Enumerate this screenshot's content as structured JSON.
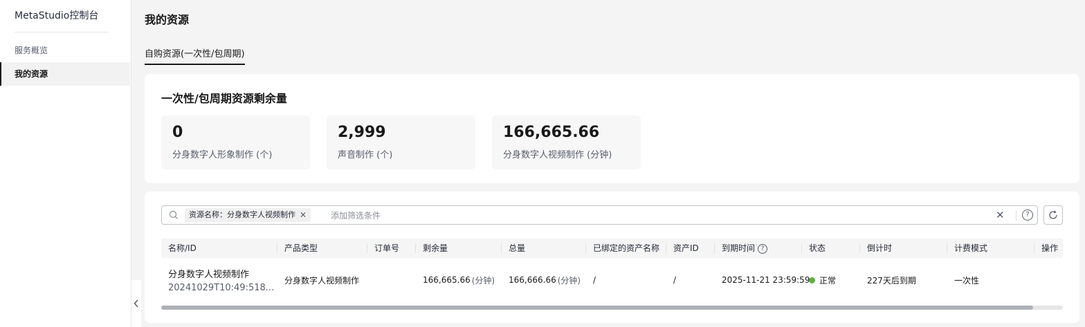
{
  "sidebar": {
    "title": "MetaStudio控制台",
    "items": [
      {
        "label": "服务概览"
      },
      {
        "label": "我的资源"
      }
    ],
    "collapse_icon": "chevron-left-icon"
  },
  "page": {
    "title": "我的资源",
    "tab": "自购资源(一次性/包周期)"
  },
  "summary": {
    "title": "一次性/包周期资源剩余量",
    "stats": [
      {
        "value": "0",
        "label": "分身数字人形象制作 (个)"
      },
      {
        "value": "2,999",
        "label": "声音制作 (个)"
      },
      {
        "value": "166,665.66",
        "label": "分身数字人视频制作 (分钟)"
      }
    ]
  },
  "search": {
    "filter_tag": "资源名称：分身数字人视频制作",
    "placeholder": "添加筛选条件",
    "help": "?"
  },
  "table": {
    "columns": [
      "名称/ID",
      "产品类型",
      "订单号",
      "剩余量",
      "总量",
      "已绑定的资产名称",
      "资产ID",
      "到期时间",
      "状态",
      "倒计时",
      "计费模式",
      "操作"
    ],
    "help_mark": "?",
    "rows": [
      {
        "name": "分身数字人视频制作",
        "id": "20241029T10:49:518...",
        "product_type": "分身数字人视频制作",
        "order_no": "",
        "remaining": "166,665.66",
        "remaining_unit": "(分钟)",
        "total": "166,666.66",
        "total_unit": "(分钟)",
        "bound_asset": "/",
        "asset_id": "/",
        "expire_time": "2025-11-21 23:59:59",
        "status": "正常",
        "countdown": "227天后到期",
        "billing_mode": "一次性",
        "action": ""
      }
    ]
  },
  "colors": {
    "status_ok": "#5fb041",
    "text_primary": "#191919",
    "text_secondary": "#575d6c"
  }
}
